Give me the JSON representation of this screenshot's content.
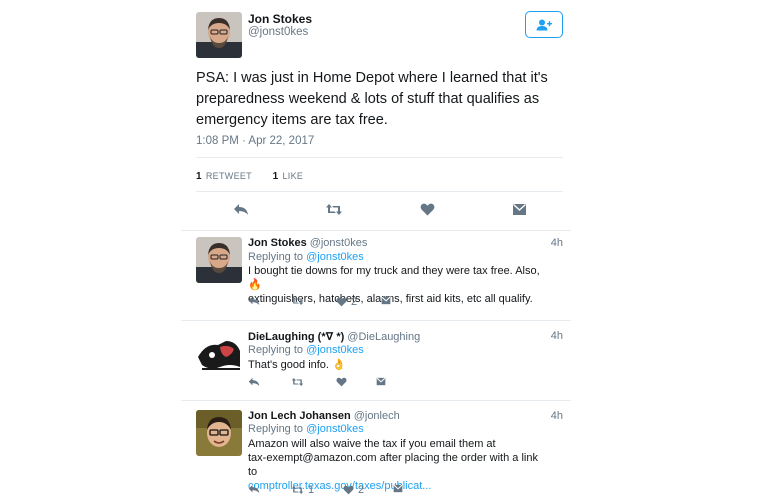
{
  "main_tweet": {
    "name": "Jon Stokes",
    "handle": "@jonst0kes",
    "text": "PSA: I was just in Home Depot where I learned that it's preparedness weekend & lots of stuff that qualifies as emergency items are tax free.",
    "timestamp": "1:08 PM · Apr 22, 2017",
    "retweets_count": "1",
    "retweets_label": "RETWEET",
    "likes_count": "1",
    "likes_label": "LIKE",
    "actions": [
      "reply-icon",
      "retweet-icon",
      "heart-icon",
      "message-icon"
    ]
  },
  "replies": [
    {
      "name": "Jon Stokes",
      "handle": "@jonst0kes",
      "time": "4h",
      "replying_prefix": "Replying to",
      "replying_to": "@jonst0kes",
      "text_line1": "I bought tie downs for my truck and they were tax free. Also, 🔥",
      "text_line2": "extinguishers, hatchets, alarms, first aid kits, etc all qualify.",
      "retweets": "",
      "likes": "2"
    },
    {
      "name": "DieLaughing (*∇ *)",
      "handle": "@DieLaughing",
      "time": "4h",
      "replying_prefix": "Replying to",
      "replying_to": "@jonst0kes",
      "text_line1": "That's good info. 👌",
      "retweets": "",
      "likes": ""
    },
    {
      "name": "Jon Lech Johansen",
      "handle": "@jonlech",
      "time": "4h",
      "replying_prefix": "Replying to",
      "replying_to": "@jonst0kes",
      "text_line1": "Amazon will also waive the tax if you email them at",
      "text_line2": "tax-exempt@amazon.com after placing the order with a link to",
      "text_link": "comptroller.texas.gov/taxes/publicat...",
      "retweets": "1",
      "likes": "2"
    }
  ],
  "colors": {
    "accent": "#1da1f2",
    "text": "#14171a",
    "secondary": "#657786",
    "divider": "#e6ecf0"
  }
}
